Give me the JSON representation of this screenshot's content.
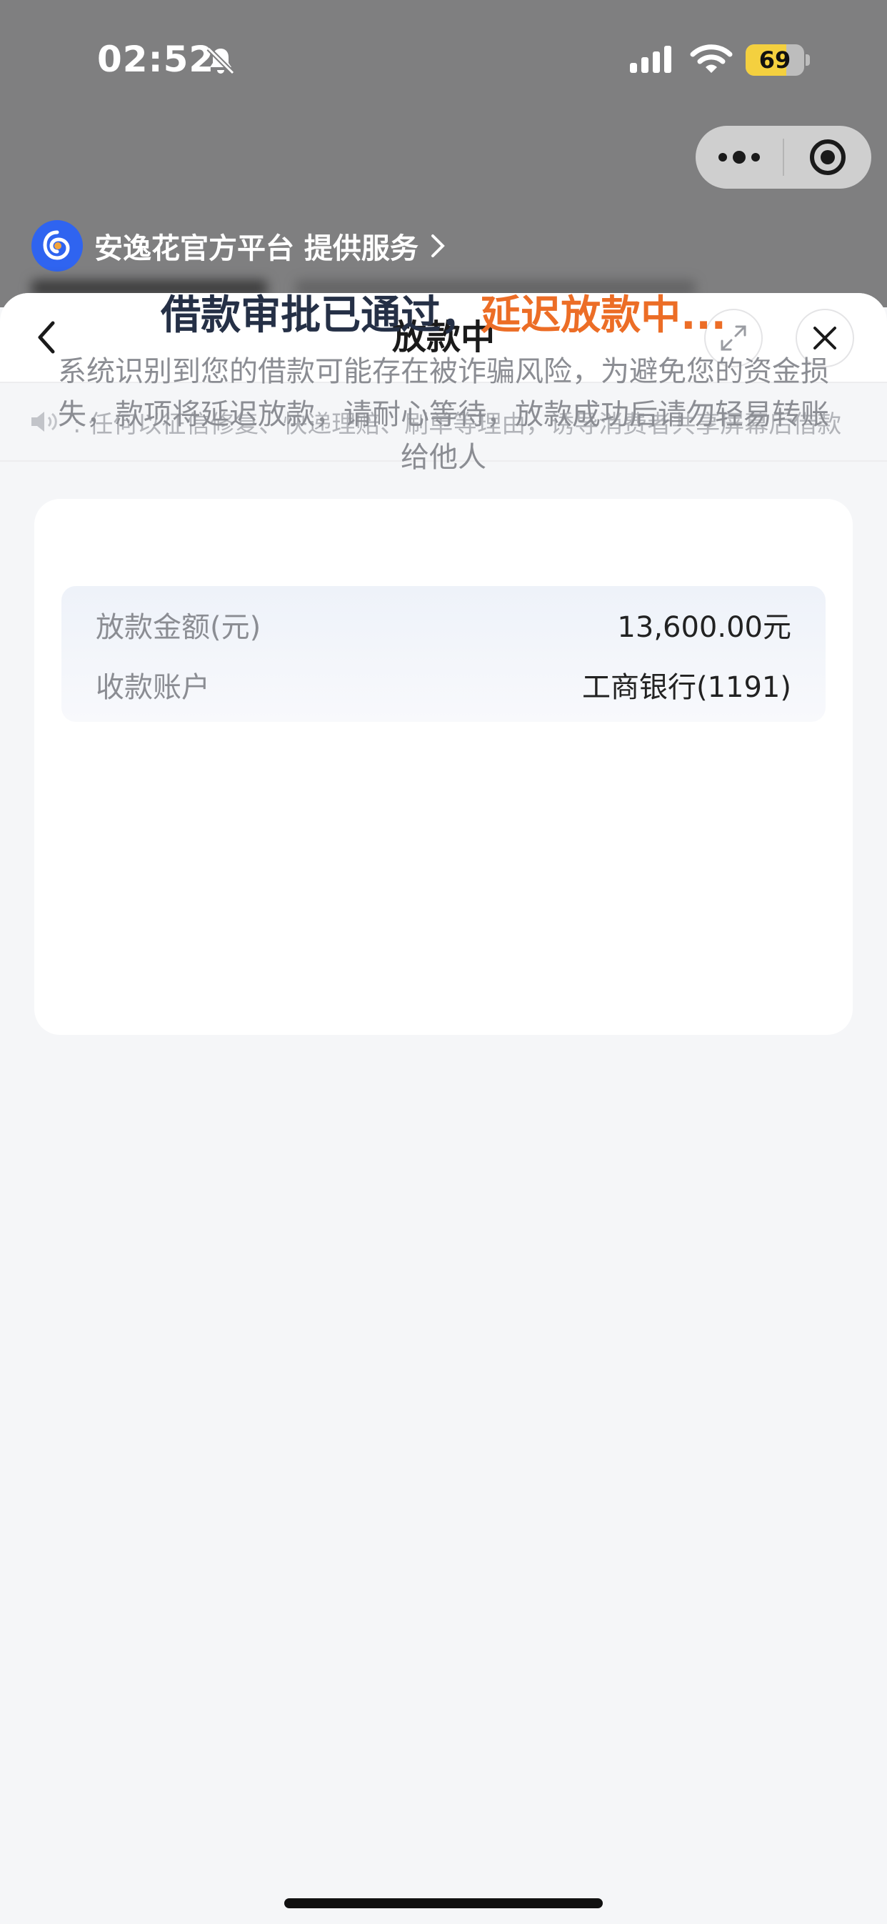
{
  "status_bar": {
    "time": "02:52",
    "battery": "69",
    "battery_level_percent": 69
  },
  "capsule": {
    "more_icon": "more-dots-icon",
    "close_icon": "target-close-icon"
  },
  "provider": {
    "text": "安逸花官方平台 提供服务"
  },
  "nav": {
    "title": "放款中"
  },
  "notice": {
    "text": ":  任何以征信修复、快递理赔、刷单等理由，诱导消费者共享屏幕后借款"
  },
  "card": {
    "title_main": "借款审批已通过，",
    "title_accent": "延迟放款中...",
    "description": "系统识别到您的借款可能存在被诈骗风险，为避免您的资金损失，款项将延迟放款，请耐心等待，放款成功后请勿轻易转账给他人",
    "rows": [
      {
        "label": "放款金额(元)",
        "value": "13,600.00元"
      },
      {
        "label": "收款账户",
        "value": "工商银行(1191)"
      }
    ]
  },
  "colors": {
    "accent": "#ec6d26",
    "title": "#253046",
    "battery_fill": "#f4d03f",
    "provider_logo": "#2f64f0"
  }
}
